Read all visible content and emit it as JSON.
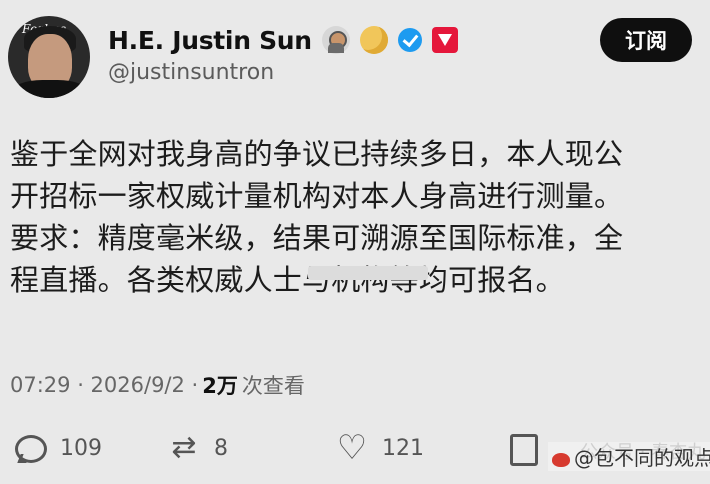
{
  "header": {
    "avatar_logo": "Forbes",
    "display_name": "H.E. Justin Sun",
    "handle": "@justinsuntron",
    "badges": [
      "astronaut-icon",
      "moon-icon",
      "verified-icon",
      "tron-logo-icon"
    ],
    "follow_label": "订阅"
  },
  "tweet": {
    "lines": [
      "鉴于全网对我身高的争议已持续多日，本人现公",
      "开招标一家权威计量机构对本人身高进行测量。",
      "要求：精度毫米级，结果可溯源至国际标准，全",
      "程直播。各类权威人士与机构等均可报名。"
    ]
  },
  "meta": {
    "time_date": "07:29 · 2026/9/2 · ",
    "views_count": "2万",
    "views_label": "次查看"
  },
  "actions": {
    "reply_count": "109",
    "retweet_count": "8",
    "like_count": "121"
  },
  "watermarks": {
    "faint": "公众号 · 春杏丸",
    "source": "@包不同的观点"
  },
  "colors": {
    "background": "#e9e9e9",
    "follow_button": "#0f0f0f",
    "verified": "#1d9bf0",
    "tron_red": "#e5173b"
  }
}
